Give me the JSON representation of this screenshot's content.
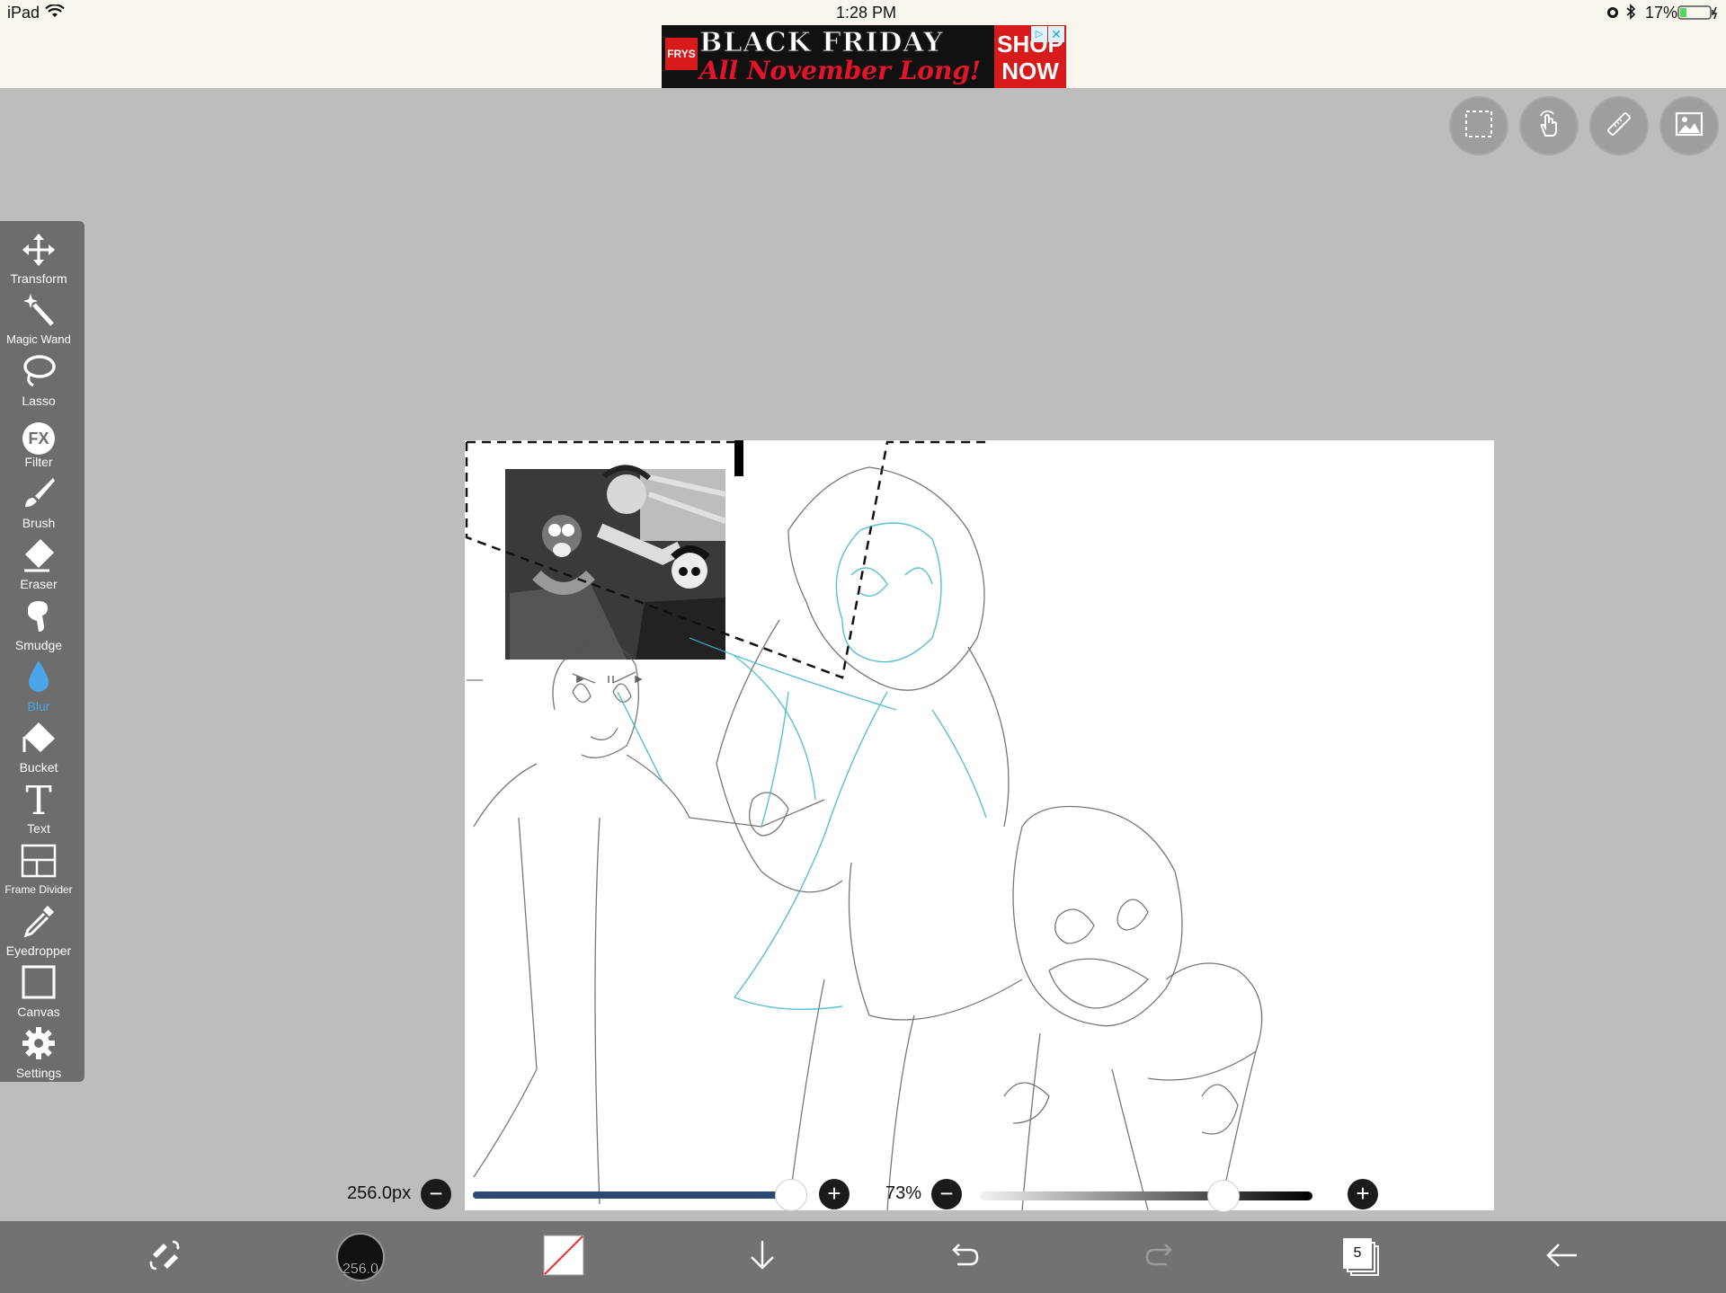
{
  "status_bar": {
    "device": "iPad",
    "time": "1:28 PM",
    "battery": "17%"
  },
  "ad": {
    "logo": "FRYS",
    "headline": "BLACK FRIDAY",
    "subline": "All November Long!",
    "cta_line1": "SHOP",
    "cta_line2": "NOW"
  },
  "top_controls": [
    {
      "name": "selection-icon"
    },
    {
      "name": "hand-icon"
    },
    {
      "name": "ruler-icon"
    },
    {
      "name": "image-icon"
    }
  ],
  "tools": {
    "transform": "Transform",
    "magic_wand": "Magic Wand",
    "lasso": "Lasso",
    "filter": "Filter",
    "filter_badge": "FX",
    "brush": "Brush",
    "eraser": "Eraser",
    "smudge": "Smudge",
    "blur": "Blur",
    "bucket": "Bucket",
    "text": "Text",
    "text_glyph": "T",
    "frame_divider": "Frame Divider",
    "eyedropper": "Eyedropper",
    "canvas": "Canvas",
    "settings": "Settings",
    "active_tool": "Blur"
  },
  "brush_size": {
    "value_label": "256.0px",
    "minus": "−",
    "plus": "+",
    "level": 0.95
  },
  "opacity": {
    "value_label": "73%",
    "minus": "−",
    "plus": "+",
    "level": 0.73
  },
  "bottom_bar": {
    "brush_size_badge": "256.0",
    "layer_count": "5"
  },
  "colors": {
    "accent_blue": "#4aa6e8",
    "slider_fill": "#2b4b72",
    "toolbar_bg": "#6d6d6d",
    "bottom_bar_bg": "#727272",
    "workspace_bg": "#bdbdbd"
  }
}
